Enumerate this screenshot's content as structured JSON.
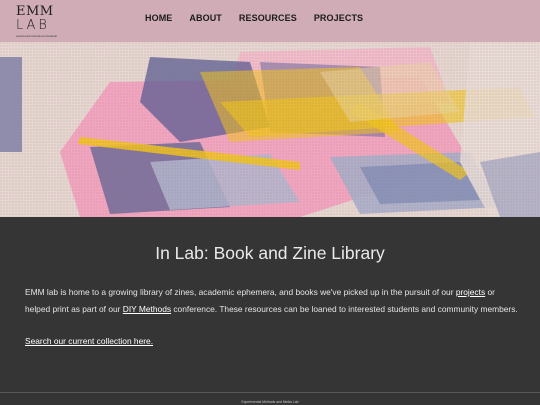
{
  "header": {
    "logo_line1": "EMM",
    "logo_line2": "LAB",
    "logo_tagline": "experimental methods and media lab"
  },
  "nav": {
    "items": [
      {
        "label": "HOME"
      },
      {
        "label": "ABOUT"
      },
      {
        "label": "RESOURCES"
      },
      {
        "label": "PROJECTS"
      }
    ]
  },
  "hero": {
    "image_colors": [
      "#e6d6d0",
      "#f0a4c0",
      "#f2c419",
      "#2d3472",
      "#a9aec8",
      "#ead6a2"
    ]
  },
  "main": {
    "title": "In Lab: Book and Zine Library",
    "paragraph_part1": "EMM lab is home to a growing library of zines, academic ephemera, and books we've picked up in the pursuit of our ",
    "projects_link": "projects",
    "paragraph_part2": " or helped print as part of our ",
    "diy_link": "DIY Methods",
    "paragraph_part3": " conference. These resources can be loaned to interested students and community members.",
    "search_link": "Search our current collection here."
  },
  "footer": {
    "text": "Experimental Methods and Media Lab"
  }
}
